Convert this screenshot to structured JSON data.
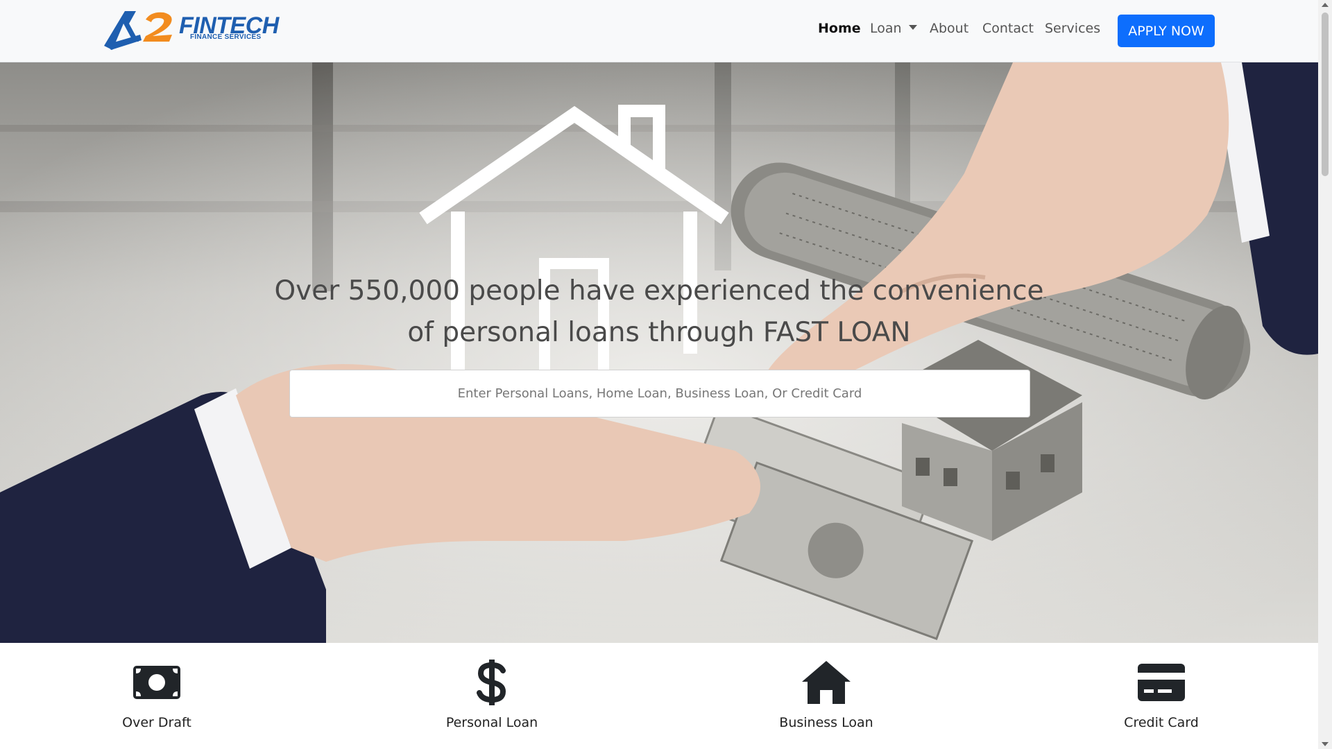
{
  "brand": {
    "logo_text": "FINTECH",
    "logo_subtext": "FINANCE SERVICES",
    "logo_mark": "A2"
  },
  "nav": {
    "home": "Home",
    "loan": "Loan",
    "about": "About",
    "contact": "Contact",
    "services": "Services",
    "apply_button": "APPLY NOW"
  },
  "hero": {
    "headline": "Over 550,000 people have experienced the convenience of personal loans through FAST LOAN",
    "search_placeholder": "Enter Personal Loans, Home Loan, Business Loan, Or Credit Card",
    "search_value": ""
  },
  "services": [
    {
      "label": "Over Draft",
      "icon": "money-bill-icon"
    },
    {
      "label": "Personal Loan",
      "icon": "dollar-icon"
    },
    {
      "label": "Business Loan",
      "icon": "home-icon"
    },
    {
      "label": "Credit Card",
      "icon": "credit-card-icon"
    }
  ],
  "colors": {
    "primary": "#0d6efd",
    "logo_blue": "#1f5fb0",
    "logo_orange": "#f28c1f",
    "navbar_bg": "#f8f9fa",
    "icon_dark": "#212529"
  }
}
